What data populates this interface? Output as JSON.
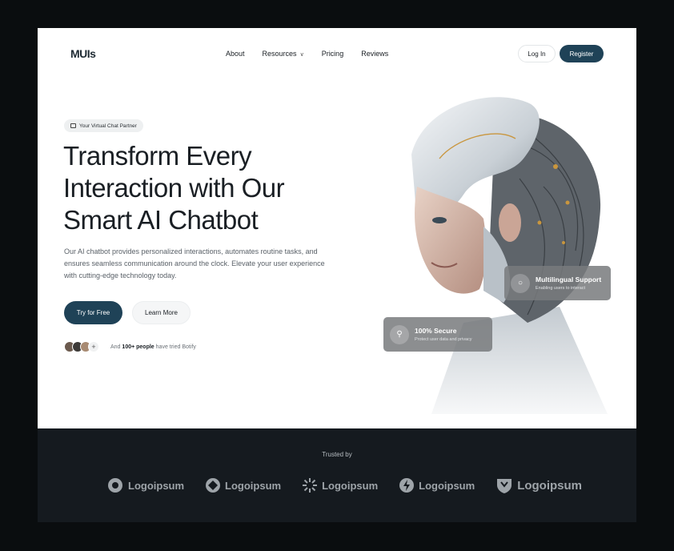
{
  "nav": {
    "logo": "MUIs",
    "items": [
      {
        "label": "About"
      },
      {
        "label": "Resources"
      },
      {
        "label": "Pricing"
      },
      {
        "label": "Reviews"
      }
    ],
    "login": "Log In",
    "register": "Register"
  },
  "hero": {
    "badge": "Your Virtual Chat Partner",
    "headline_1": "Transform Every",
    "headline_2": "Interaction with Our",
    "headline_3": "Smart AI Chatbot",
    "description": "Our AI chatbot provides personalized interactions, automates routine tasks, and ensures seamless communication around the clock. Elevate your user experience with cutting-edge technology today.",
    "cta_primary": "Try for Free",
    "cta_secondary": "Learn More",
    "proof_prefix": "And",
    "proof_count": "100+ people",
    "proof_suffix": "have tried Botify",
    "plus": "+"
  },
  "cards": {
    "multilingual_title": "Multilingual Support",
    "multilingual_sub": "Enabling users to interact",
    "secure_title": "100% Secure",
    "secure_sub": "Protect user data and privacy"
  },
  "trusted": {
    "label": "Trusted by",
    "logos": [
      "Logoipsum",
      "Logoipsum",
      "Logoipsum",
      "Logoipsum",
      "Logoipsum"
    ]
  },
  "colors": {
    "accent": "#1f4257",
    "dark_band": "#151a1f"
  }
}
